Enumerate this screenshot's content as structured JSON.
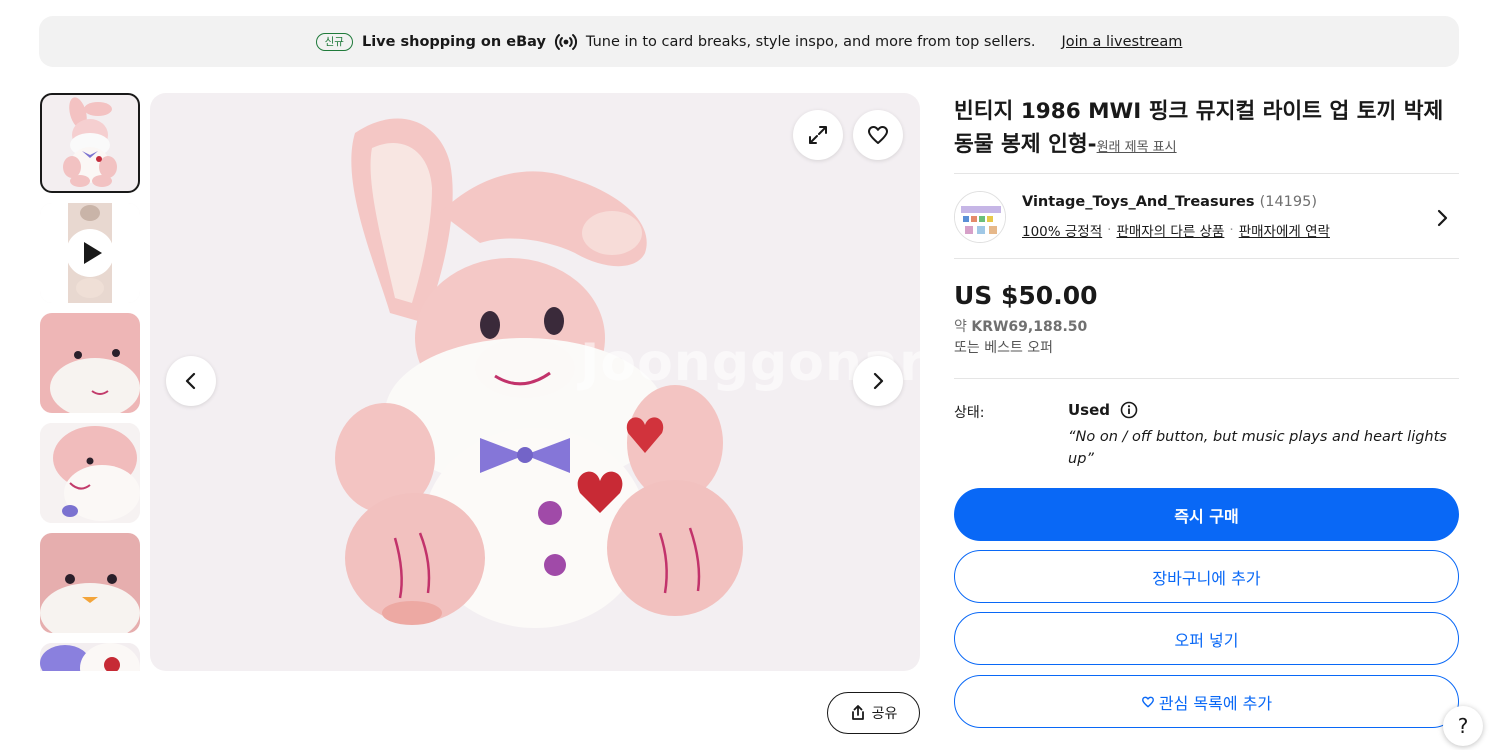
{
  "banner": {
    "badge": "신규",
    "title": "Live shopping on eBay",
    "description": "Tune in to card breaks, style inspo, and more from top sellers.",
    "link": "Join a livestream",
    "icon": "live-broadcast-icon"
  },
  "gallery": {
    "thumbnails": [
      {
        "kind": "image",
        "subject": "rabbit-full"
      },
      {
        "kind": "video",
        "subject": "rabbit-video"
      },
      {
        "kind": "image",
        "subject": "rabbit-face-closeup"
      },
      {
        "kind": "image",
        "subject": "rabbit-face-side"
      },
      {
        "kind": "image",
        "subject": "rabbit-face-front"
      },
      {
        "kind": "image",
        "subject": "rabbit-heart-detail"
      }
    ],
    "watermark": "Joonggonara",
    "icons": {
      "expand": "expand-icon",
      "favorite": "heart-icon",
      "prev": "chevron-left-icon",
      "next": "chevron-right-icon",
      "play": "play-icon"
    },
    "share_label": "공유"
  },
  "product": {
    "title": "빈티지 1986 MWI 핑크 뮤지컬 라이트 업 토끼 박제 동물 봉제 인형-",
    "original_title_link": "원래 제목 표시"
  },
  "seller": {
    "name": "Vintage_Toys_And_Treasures",
    "feedback_count": "(14195)",
    "positive": "100% 긍정적",
    "other_items": "판매자의 다른 상품",
    "contact": "판매자에게 연락",
    "separator": "·"
  },
  "price": {
    "main": "US $50.00",
    "approx_prefix": "약",
    "approx_value": "KRW69,188.50",
    "best_offer": "또는 베스트 오퍼"
  },
  "condition": {
    "label": "상태:",
    "value": "Used",
    "note": "“No on / off button, but music plays and heart lights up”"
  },
  "actions": {
    "buy_now": "즉시 구매",
    "add_to_cart": "장바구니에 추가",
    "make_offer": "오퍼 넣기",
    "watchlist": "관심 목록에 추가"
  },
  "help": "?",
  "colors": {
    "primary": "#0968f6",
    "badge_green": "#1f7a3a",
    "banner_bg": "#f2f2f2",
    "text": "#191919"
  }
}
